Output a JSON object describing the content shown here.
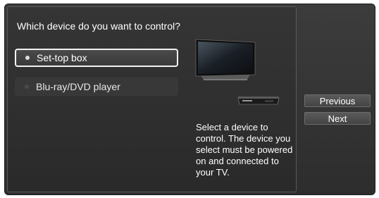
{
  "question": "Which device do you want to control?",
  "options": [
    {
      "label": "Set-top box",
      "selected": true
    },
    {
      "label": "Blu-ray/DVD player",
      "selected": false
    }
  ],
  "description": "Select a device to control. The device you select must be powered on and connected to your TV.",
  "buttons": {
    "previous": "Previous",
    "next": "Next"
  },
  "icons": {
    "tv": "tv-icon",
    "set_top_box": "set-top-box-icon"
  },
  "colors": {
    "background": "#2d2d2d",
    "selected_border": "#f2f2f2",
    "text": "#ffffff"
  }
}
